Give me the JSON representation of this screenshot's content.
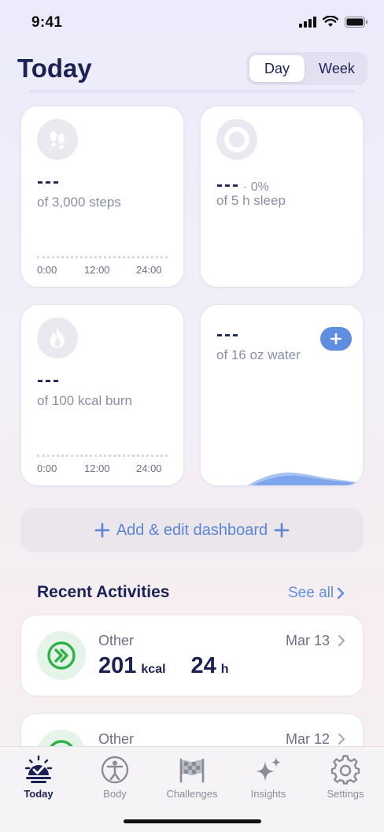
{
  "status_bar": {
    "time": "9:41"
  },
  "header": {
    "title": "Today",
    "segments": {
      "day": "Day",
      "week": "Week",
      "selected": "Day"
    }
  },
  "cards": {
    "steps": {
      "value": "---",
      "goal": "of 3,000 steps",
      "axis": [
        "0:00",
        "12:00",
        "24:00"
      ],
      "icon": "footprints-icon"
    },
    "sleep": {
      "value": "---",
      "percent": "· 0%",
      "goal": "of 5 h sleep",
      "icon": "sleep-ring-icon"
    },
    "burn": {
      "value": "---",
      "goal": "of 100 kcal burn",
      "axis": [
        "0:00",
        "12:00",
        "24:00"
      ],
      "icon": "flame-icon"
    },
    "water": {
      "value": "---",
      "goal": "of 16 oz water",
      "add_icon": "plus-icon"
    }
  },
  "dashboard_button": {
    "label": "Add & edit dashboard"
  },
  "recent": {
    "title": "Recent Activities",
    "see_all": "See all",
    "items": [
      {
        "type": "Other",
        "date": "Mar 13",
        "calories": "201",
        "calories_unit": "kcal",
        "duration": "24",
        "duration_unit": "h",
        "icon": "double-chevron-icon"
      },
      {
        "type": "Other",
        "date": "Mar 12",
        "icon": "double-chevron-icon"
      }
    ]
  },
  "tabs": [
    {
      "label": "Today",
      "icon": "today-icon",
      "active": true
    },
    {
      "label": "Body",
      "icon": "body-icon",
      "active": false
    },
    {
      "label": "Challenges",
      "icon": "flag-icon",
      "active": false
    },
    {
      "label": "Insights",
      "icon": "sparkle-icon",
      "active": false
    },
    {
      "label": "Settings",
      "icon": "gear-icon",
      "active": false
    }
  ],
  "colors": {
    "accent": "#5f8de0",
    "title": "#1b2155",
    "activity_green": "#2fb14a"
  }
}
